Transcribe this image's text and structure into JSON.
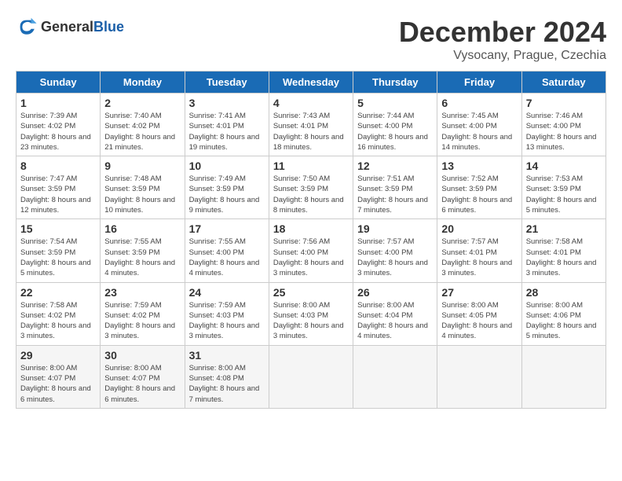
{
  "header": {
    "logo_general": "General",
    "logo_blue": "Blue",
    "month": "December 2024",
    "location": "Vysocany, Prague, Czechia"
  },
  "weekdays": [
    "Sunday",
    "Monday",
    "Tuesday",
    "Wednesday",
    "Thursday",
    "Friday",
    "Saturday"
  ],
  "weeks": [
    [
      {
        "day": 1,
        "sunrise": "7:39 AM",
        "sunset": "4:02 PM",
        "daylight": "8 hours and 23 minutes."
      },
      {
        "day": 2,
        "sunrise": "7:40 AM",
        "sunset": "4:02 PM",
        "daylight": "8 hours and 21 minutes."
      },
      {
        "day": 3,
        "sunrise": "7:41 AM",
        "sunset": "4:01 PM",
        "daylight": "8 hours and 19 minutes."
      },
      {
        "day": 4,
        "sunrise": "7:43 AM",
        "sunset": "4:01 PM",
        "daylight": "8 hours and 18 minutes."
      },
      {
        "day": 5,
        "sunrise": "7:44 AM",
        "sunset": "4:00 PM",
        "daylight": "8 hours and 16 minutes."
      },
      {
        "day": 6,
        "sunrise": "7:45 AM",
        "sunset": "4:00 PM",
        "daylight": "8 hours and 14 minutes."
      },
      {
        "day": 7,
        "sunrise": "7:46 AM",
        "sunset": "4:00 PM",
        "daylight": "8 hours and 13 minutes."
      }
    ],
    [
      {
        "day": 8,
        "sunrise": "7:47 AM",
        "sunset": "3:59 PM",
        "daylight": "8 hours and 12 minutes."
      },
      {
        "day": 9,
        "sunrise": "7:48 AM",
        "sunset": "3:59 PM",
        "daylight": "8 hours and 10 minutes."
      },
      {
        "day": 10,
        "sunrise": "7:49 AM",
        "sunset": "3:59 PM",
        "daylight": "8 hours and 9 minutes."
      },
      {
        "day": 11,
        "sunrise": "7:50 AM",
        "sunset": "3:59 PM",
        "daylight": "8 hours and 8 minutes."
      },
      {
        "day": 12,
        "sunrise": "7:51 AM",
        "sunset": "3:59 PM",
        "daylight": "8 hours and 7 minutes."
      },
      {
        "day": 13,
        "sunrise": "7:52 AM",
        "sunset": "3:59 PM",
        "daylight": "8 hours and 6 minutes."
      },
      {
        "day": 14,
        "sunrise": "7:53 AM",
        "sunset": "3:59 PM",
        "daylight": "8 hours and 5 minutes."
      }
    ],
    [
      {
        "day": 15,
        "sunrise": "7:54 AM",
        "sunset": "3:59 PM",
        "daylight": "8 hours and 5 minutes."
      },
      {
        "day": 16,
        "sunrise": "7:55 AM",
        "sunset": "3:59 PM",
        "daylight": "8 hours and 4 minutes."
      },
      {
        "day": 17,
        "sunrise": "7:55 AM",
        "sunset": "4:00 PM",
        "daylight": "8 hours and 4 minutes."
      },
      {
        "day": 18,
        "sunrise": "7:56 AM",
        "sunset": "4:00 PM",
        "daylight": "8 hours and 3 minutes."
      },
      {
        "day": 19,
        "sunrise": "7:57 AM",
        "sunset": "4:00 PM",
        "daylight": "8 hours and 3 minutes."
      },
      {
        "day": 20,
        "sunrise": "7:57 AM",
        "sunset": "4:01 PM",
        "daylight": "8 hours and 3 minutes."
      },
      {
        "day": 21,
        "sunrise": "7:58 AM",
        "sunset": "4:01 PM",
        "daylight": "8 hours and 3 minutes."
      }
    ],
    [
      {
        "day": 22,
        "sunrise": "7:58 AM",
        "sunset": "4:02 PM",
        "daylight": "8 hours and 3 minutes."
      },
      {
        "day": 23,
        "sunrise": "7:59 AM",
        "sunset": "4:02 PM",
        "daylight": "8 hours and 3 minutes."
      },
      {
        "day": 24,
        "sunrise": "7:59 AM",
        "sunset": "4:03 PM",
        "daylight": "8 hours and 3 minutes."
      },
      {
        "day": 25,
        "sunrise": "8:00 AM",
        "sunset": "4:03 PM",
        "daylight": "8 hours and 3 minutes."
      },
      {
        "day": 26,
        "sunrise": "8:00 AM",
        "sunset": "4:04 PM",
        "daylight": "8 hours and 4 minutes."
      },
      {
        "day": 27,
        "sunrise": "8:00 AM",
        "sunset": "4:05 PM",
        "daylight": "8 hours and 4 minutes."
      },
      {
        "day": 28,
        "sunrise": "8:00 AM",
        "sunset": "4:06 PM",
        "daylight": "8 hours and 5 minutes."
      }
    ],
    [
      {
        "day": 29,
        "sunrise": "8:00 AM",
        "sunset": "4:07 PM",
        "daylight": "8 hours and 6 minutes."
      },
      {
        "day": 30,
        "sunrise": "8:00 AM",
        "sunset": "4:07 PM",
        "daylight": "8 hours and 6 minutes."
      },
      {
        "day": 31,
        "sunrise": "8:00 AM",
        "sunset": "4:08 PM",
        "daylight": "8 hours and 7 minutes."
      },
      null,
      null,
      null,
      null
    ]
  ]
}
